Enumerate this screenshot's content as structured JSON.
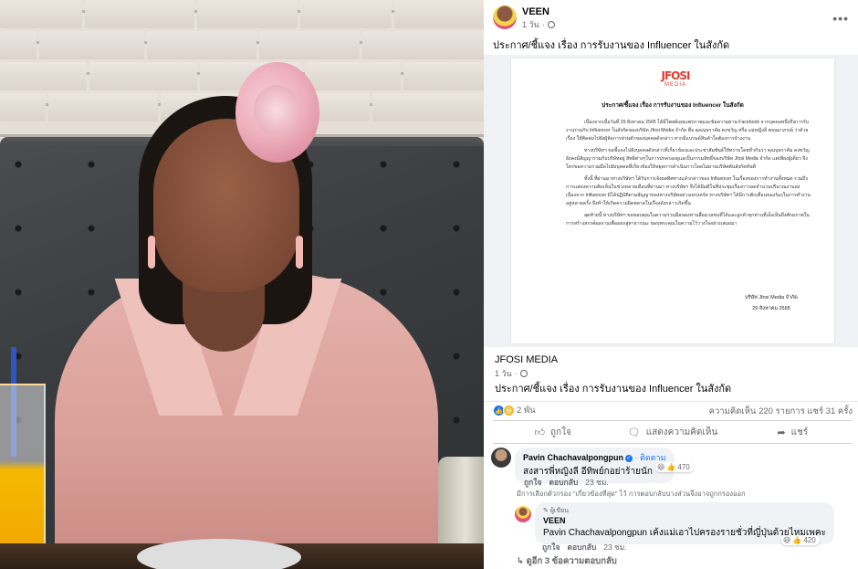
{
  "post": {
    "author": "VEEN",
    "time": "1 วัน",
    "text": "ประกาศ/ชี้แจง เรื่อง การรับงานของ Influencer ในสังกัด"
  },
  "document": {
    "logo_mark": "JFOSI",
    "logo_sub": "MEDIA",
    "title": "ประกาศ/ชี้แจง เรื่อง การรับงานของ Influencer ในสังกัด",
    "paragraphs": [
      "เนื่องจากเมื่อวันที่ 29 สิงหาคม 2565 ได้มีโพสต์เผยแพร่ภาพและข้อความผ่าน Facebook จากบุคคลหนึ่งถึงการรับงานร่วมกับ Influencer ในสังกัดของบริษัท Jfosi Media จำกัด คือ คุณบุษราคัม คงขวัญ หรือ แม่หญิงลี พจนมาภรณ์ ว่าด้วยเรื่อง ให้ติดต่อไปยังผู้จัดการส่วนตัวของบุคคลดังกล่าว หากมีแบรนด์สินค้าใดต้องการจ้างงาน",
      "ทางบริษัทฯ ขอชี้แจงไปยังบุคคลดังกล่าวที่เกี่ยวข้องและประชาสัมพันธ์ให้ทราบโดยทั่วกันว่า คุณบุษราคัม คงขวัญ ยังคงมีสัญญาร่วมกับบริษัทอยู่ สิทธิต่างๆในการปกครองดูแลเป็นกรรมสิทธิ์ของบริษัท Jfosi Media จำกัด แต่เพียงผู้เดียว จึงใคร่ขอความร่วมมือไปยังบุคคลที่เกี่ยวข้องให้หยุดการดำเนินการโดยไม่ผ่านบริษัทต้นสังกัดทันที",
      "ทั้งนี้ ที่ผ่านมาทางบริษัทฯ ได้รับการเจ้งผลทิศทางแล้วกล่าวของ Influencer ในเรื่องของการทำงานทั้งหมด รวมถึงการแสดงความคิดเห็นในช่วงหลายเดือนที่ผ่านมา ทางบริษัทฯ จึงได้มีมติในที่ประชุมเรื่องการลดจำนวนปริมาณงานลง เนื่องจาก Influencer มิได้ปฏิบัติตามสัญญาของทางบริษัทอย่างเคร่งครัด ทางบริษัทฯ ได้มีการตักเตือนของร้องในการทำงานอยู่หลายครั้ง จึงทำให้เกิดความผิดพลาดในเรื่องดังกล่าวเกิดขึ้น",
      "สุดท้ายนี้ ทางบริษัทฯ ขอขอบคุณในความร่วมมือของท่านสื่อมวลชนที่ได้และลูกค้าทุกท่านที่เล็งเห็นถึงศักยภาพในการสร้างสรรค์ผลงานเพื่อออกสู่สาธารณะ ขอบพระคุณในความไว้วางใจอย่างเสมอมา"
    ],
    "signature_company": "บริษัท Jfosi Media จำกัด",
    "signature_date": "29 สิงหาคม 2565"
  },
  "shared": {
    "name": "JFOSI MEDIA",
    "time": "1 วัน",
    "text": "ประกาศ/ชี้แจง เรื่อง การรับงานของ Influencer ในสังกัด"
  },
  "stats": {
    "reaction_count": "2 พัน",
    "summary": "ความคิดเห็น 220 รายการ  แชร์ 31 ครั้ง"
  },
  "actions": {
    "like": "ถูกใจ",
    "comment": "แสดงความคิดเห็น",
    "share": "แชร์"
  },
  "comments": [
    {
      "name": "Pavin Chachavalpongpun",
      "follow": "· ติดตาม",
      "text": "สงสารพี่หญิงลี อีทิพย์กอย่าร้ายนัก",
      "reactions": "470",
      "like": "ถูกใจ",
      "reply": "ตอบกลับ",
      "time": "23 ชม.",
      "note": "มีการเลือกตัวกรอง \"เกี่ยวข้องที่สุด\" ไว้ การตอบกลับบางส่วนจึงอาจถูกกรองออก"
    },
    {
      "tag": "ผู้เขียน",
      "name": "VEEN",
      "text": "Pavin Chachavalpongpun เค้งแม่เอาไปครองรายชั่วที่ญี่ปุ่นด้วยไหมเพคะ",
      "reactions": "420",
      "like": "ถูกใจ",
      "reply": "ตอบกลับ",
      "time": "23 ชม."
    }
  ],
  "view_more": "ดูอีก 3 ข้อความตอบกลับ",
  "icons": {
    "like": "thumbs-up-icon",
    "comment": "speech-bubble-icon",
    "share": "share-arrow-icon"
  },
  "colors": {
    "fb_blue": "#1877f2",
    "secondary_text": "#65676b",
    "bubble_bg": "#f0f2f5",
    "logo_red": "#e23b2e"
  }
}
